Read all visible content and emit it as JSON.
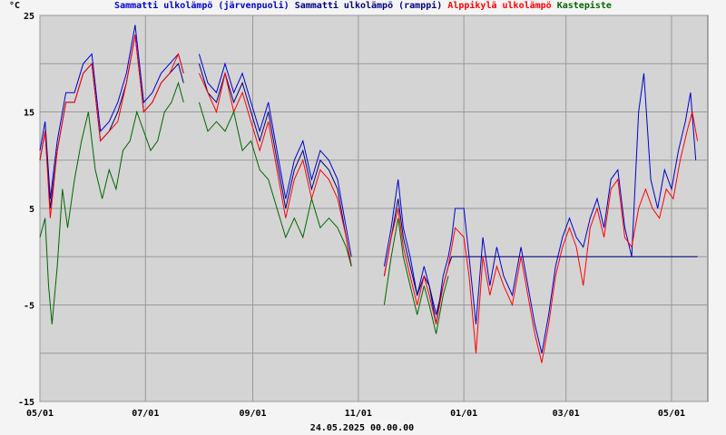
{
  "chart_data": {
    "type": "line",
    "unit_label": "°C",
    "timestamp": "24.05.2025 00.00.00",
    "ylim": [
      -15,
      25
    ],
    "yticks": [
      -15,
      -5,
      5,
      15,
      25
    ],
    "xlim": [
      0,
      386
    ],
    "x_ticks": [
      {
        "day": 0,
        "label": "05/01"
      },
      {
        "day": 61,
        "label": "07/01"
      },
      {
        "day": 123,
        "label": "09/01"
      },
      {
        "day": 184,
        "label": "11/01"
      },
      {
        "day": 245,
        "label": "01/01"
      },
      {
        "day": 304,
        "label": "03/01"
      },
      {
        "day": 365,
        "label": "05/01"
      }
    ],
    "grid": true,
    "legend_position": "top",
    "series": [
      {
        "name": "Sammatti ulkolämpö (järvenpuoli)",
        "color": "#0000cc",
        "points": [
          [
            0,
            11
          ],
          [
            3,
            14
          ],
          [
            6,
            6
          ],
          [
            10,
            12
          ],
          [
            15,
            17
          ],
          [
            20,
            17
          ],
          [
            25,
            20
          ],
          [
            30,
            21
          ],
          [
            35,
            13
          ],
          [
            40,
            14
          ],
          [
            45,
            16
          ],
          [
            50,
            19
          ],
          [
            55,
            24
          ],
          [
            60,
            16
          ],
          [
            65,
            17
          ],
          [
            70,
            19
          ],
          [
            75,
            20
          ],
          [
            80,
            21
          ],
          [
            83,
            19
          ],
          [
            null,
            null
          ],
          [
            92,
            21
          ],
          [
            97,
            18
          ],
          [
            102,
            17
          ],
          [
            107,
            20
          ],
          [
            112,
            17
          ],
          [
            117,
            19
          ],
          [
            122,
            16
          ],
          [
            127,
            13
          ],
          [
            132,
            16
          ],
          [
            137,
            11
          ],
          [
            142,
            6
          ],
          [
            147,
            10
          ],
          [
            152,
            12
          ],
          [
            157,
            8
          ],
          [
            162,
            11
          ],
          [
            167,
            10
          ],
          [
            172,
            8
          ],
          [
            177,
            3
          ],
          [
            180,
            0
          ],
          [
            null,
            null
          ],
          [
            199,
            -1
          ],
          [
            203,
            3
          ],
          [
            207,
            8
          ],
          [
            210,
            3
          ],
          [
            214,
            0
          ],
          [
            218,
            -4
          ],
          [
            222,
            -1
          ],
          [
            225,
            -3
          ],
          [
            229,
            -7
          ],
          [
            233,
            -2
          ],
          [
            236,
            0
          ],
          [
            238,
            2
          ],
          [
            240,
            5
          ],
          [
            245,
            5
          ],
          [
            248,
            0
          ],
          [
            252,
            -7
          ],
          [
            256,
            2
          ],
          [
            260,
            -3
          ],
          [
            264,
            1
          ],
          [
            268,
            -2
          ],
          [
            273,
            -4
          ],
          [
            278,
            1
          ],
          [
            282,
            -3
          ],
          [
            286,
            -7
          ],
          [
            290,
            -10
          ],
          [
            294,
            -6
          ],
          [
            298,
            -1
          ],
          [
            302,
            2
          ],
          [
            306,
            4
          ],
          [
            310,
            2
          ],
          [
            314,
            1
          ],
          [
            318,
            4
          ],
          [
            322,
            6
          ],
          [
            326,
            3
          ],
          [
            330,
            8
          ],
          [
            334,
            9
          ],
          [
            338,
            3
          ],
          [
            342,
            0
          ],
          [
            346,
            15
          ],
          [
            349,
            19
          ],
          [
            353,
            8
          ],
          [
            357,
            5
          ],
          [
            361,
            9
          ],
          [
            365,
            7
          ],
          [
            369,
            11
          ],
          [
            373,
            14
          ],
          [
            376,
            17
          ],
          [
            379,
            10
          ]
        ]
      },
      {
        "name": "Sammatti ulkolämpö (ramppi)",
        "color": "#000080",
        "points": [
          [
            0,
            10
          ],
          [
            3,
            13
          ],
          [
            6,
            5
          ],
          [
            10,
            11
          ],
          [
            15,
            16
          ],
          [
            20,
            16
          ],
          [
            25,
            19
          ],
          [
            30,
            20
          ],
          [
            35,
            12
          ],
          [
            40,
            13
          ],
          [
            45,
            15
          ],
          [
            50,
            18
          ],
          [
            55,
            23
          ],
          [
            60,
            15
          ],
          [
            65,
            16
          ],
          [
            70,
            18
          ],
          [
            75,
            19
          ],
          [
            80,
            20
          ],
          [
            83,
            18
          ],
          [
            null,
            null
          ],
          [
            92,
            20
          ],
          [
            97,
            17
          ],
          [
            102,
            16
          ],
          [
            107,
            19
          ],
          [
            112,
            16
          ],
          [
            117,
            18
          ],
          [
            122,
            15
          ],
          [
            127,
            12
          ],
          [
            132,
            15
          ],
          [
            137,
            10
          ],
          [
            142,
            5
          ],
          [
            147,
            9
          ],
          [
            152,
            11
          ],
          [
            157,
            7
          ],
          [
            162,
            10
          ],
          [
            167,
            9
          ],
          [
            172,
            7
          ],
          [
            177,
            2
          ],
          [
            180,
            -1
          ],
          [
            null,
            null
          ],
          [
            199,
            -2
          ],
          [
            203,
            2
          ],
          [
            207,
            6
          ],
          [
            210,
            2
          ],
          [
            214,
            -1
          ],
          [
            218,
            -4
          ],
          [
            222,
            -2
          ],
          [
            225,
            -3
          ],
          [
            229,
            -6
          ],
          [
            233,
            -3
          ],
          [
            236,
            -1
          ],
          [
            238,
            0
          ],
          [
            340,
            0
          ],
          [
            380,
            0
          ]
        ]
      },
      {
        "name": "Alppikylä ulkolämpö",
        "color": "#ff0000",
        "points": [
          [
            0,
            10
          ],
          [
            3,
            13
          ],
          [
            6,
            4
          ],
          [
            10,
            11
          ],
          [
            15,
            16
          ],
          [
            20,
            16
          ],
          [
            25,
            19
          ],
          [
            30,
            20
          ],
          [
            35,
            12
          ],
          [
            40,
            13
          ],
          [
            45,
            14
          ],
          [
            50,
            18
          ],
          [
            55,
            23
          ],
          [
            60,
            15
          ],
          [
            65,
            16
          ],
          [
            70,
            18
          ],
          [
            75,
            19
          ],
          [
            80,
            21
          ],
          [
            83,
            19
          ],
          [
            null,
            null
          ],
          [
            92,
            19
          ],
          [
            97,
            17
          ],
          [
            102,
            15
          ],
          [
            107,
            19
          ],
          [
            112,
            15
          ],
          [
            117,
            17
          ],
          [
            122,
            14
          ],
          [
            127,
            11
          ],
          [
            132,
            14
          ],
          [
            137,
            9
          ],
          [
            142,
            4
          ],
          [
            147,
            8
          ],
          [
            152,
            10
          ],
          [
            157,
            6
          ],
          [
            162,
            9
          ],
          [
            167,
            8
          ],
          [
            172,
            6
          ],
          [
            177,
            2
          ],
          [
            180,
            -1
          ],
          [
            null,
            null
          ],
          [
            199,
            -2
          ],
          [
            203,
            2
          ],
          [
            207,
            5
          ],
          [
            210,
            1
          ],
          [
            214,
            -2
          ],
          [
            218,
            -5
          ],
          [
            222,
            -2
          ],
          [
            225,
            -4
          ],
          [
            229,
            -7
          ],
          [
            233,
            -3
          ],
          [
            236,
            -1
          ],
          [
            240,
            3
          ],
          [
            245,
            2
          ],
          [
            248,
            -2
          ],
          [
            252,
            -10
          ],
          [
            256,
            0
          ],
          [
            260,
            -4
          ],
          [
            264,
            -1
          ],
          [
            268,
            -3
          ],
          [
            273,
            -5
          ],
          [
            278,
            0
          ],
          [
            282,
            -4
          ],
          [
            286,
            -8
          ],
          [
            290,
            -11
          ],
          [
            294,
            -7
          ],
          [
            298,
            -2
          ],
          [
            302,
            1
          ],
          [
            306,
            3
          ],
          [
            310,
            1
          ],
          [
            314,
            -3
          ],
          [
            318,
            3
          ],
          [
            322,
            5
          ],
          [
            326,
            2
          ],
          [
            330,
            7
          ],
          [
            334,
            8
          ],
          [
            338,
            2
          ],
          [
            342,
            1
          ],
          [
            346,
            5
          ],
          [
            350,
            7
          ],
          [
            354,
            5
          ],
          [
            358,
            4
          ],
          [
            362,
            7
          ],
          [
            366,
            6
          ],
          [
            370,
            10
          ],
          [
            374,
            13
          ],
          [
            377,
            15
          ],
          [
            380,
            12
          ]
        ]
      },
      {
        "name": "Kastepiste",
        "color": "#006600",
        "points": [
          [
            0,
            2
          ],
          [
            3,
            4
          ],
          [
            5,
            -3
          ],
          [
            7,
            -7
          ],
          [
            10,
            -1
          ],
          [
            13,
            7
          ],
          [
            16,
            3
          ],
          [
            20,
            8
          ],
          [
            24,
            12
          ],
          [
            28,
            15
          ],
          [
            32,
            9
          ],
          [
            36,
            6
          ],
          [
            40,
            9
          ],
          [
            44,
            7
          ],
          [
            48,
            11
          ],
          [
            52,
            12
          ],
          [
            56,
            15
          ],
          [
            60,
            13
          ],
          [
            64,
            11
          ],
          [
            68,
            12
          ],
          [
            72,
            15
          ],
          [
            76,
            16
          ],
          [
            80,
            18
          ],
          [
            83,
            16
          ],
          [
            null,
            null
          ],
          [
            92,
            16
          ],
          [
            97,
            13
          ],
          [
            102,
            14
          ],
          [
            107,
            13
          ],
          [
            112,
            15
          ],
          [
            117,
            11
          ],
          [
            122,
            12
          ],
          [
            127,
            9
          ],
          [
            132,
            8
          ],
          [
            137,
            5
          ],
          [
            142,
            2
          ],
          [
            147,
            4
          ],
          [
            152,
            2
          ],
          [
            157,
            6
          ],
          [
            162,
            3
          ],
          [
            167,
            4
          ],
          [
            172,
            3
          ],
          [
            177,
            1
          ],
          [
            180,
            -1
          ],
          [
            null,
            null
          ],
          [
            199,
            -5
          ],
          [
            203,
            0
          ],
          [
            207,
            4
          ],
          [
            210,
            0
          ],
          [
            214,
            -3
          ],
          [
            218,
            -6
          ],
          [
            222,
            -3
          ],
          [
            225,
            -5
          ],
          [
            229,
            -8
          ],
          [
            233,
            -4
          ],
          [
            236,
            -2
          ]
        ]
      }
    ]
  }
}
